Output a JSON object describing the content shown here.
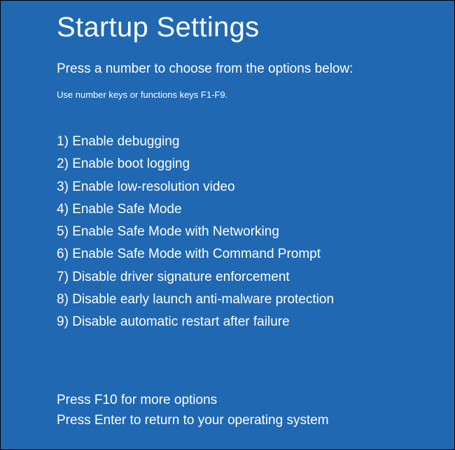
{
  "title": "Startup Settings",
  "instruction": "Press a number to choose from the options below:",
  "hint": "Use number keys or functions keys F1-F9.",
  "options": [
    {
      "num": "1",
      "label": "Enable debugging"
    },
    {
      "num": "2",
      "label": "Enable boot logging"
    },
    {
      "num": "3",
      "label": "Enable low-resolution video"
    },
    {
      "num": "4",
      "label": "Enable Safe Mode"
    },
    {
      "num": "5",
      "label": "Enable Safe Mode with Networking"
    },
    {
      "num": "6",
      "label": "Enable Safe Mode with Command Prompt"
    },
    {
      "num": "7",
      "label": "Disable driver signature enforcement"
    },
    {
      "num": "8",
      "label": "Disable early launch anti-malware protection"
    },
    {
      "num": "9",
      "label": "Disable automatic restart after failure"
    }
  ],
  "footer": {
    "more_options": "Press F10 for more options",
    "return": "Press Enter to return to your operating system"
  }
}
